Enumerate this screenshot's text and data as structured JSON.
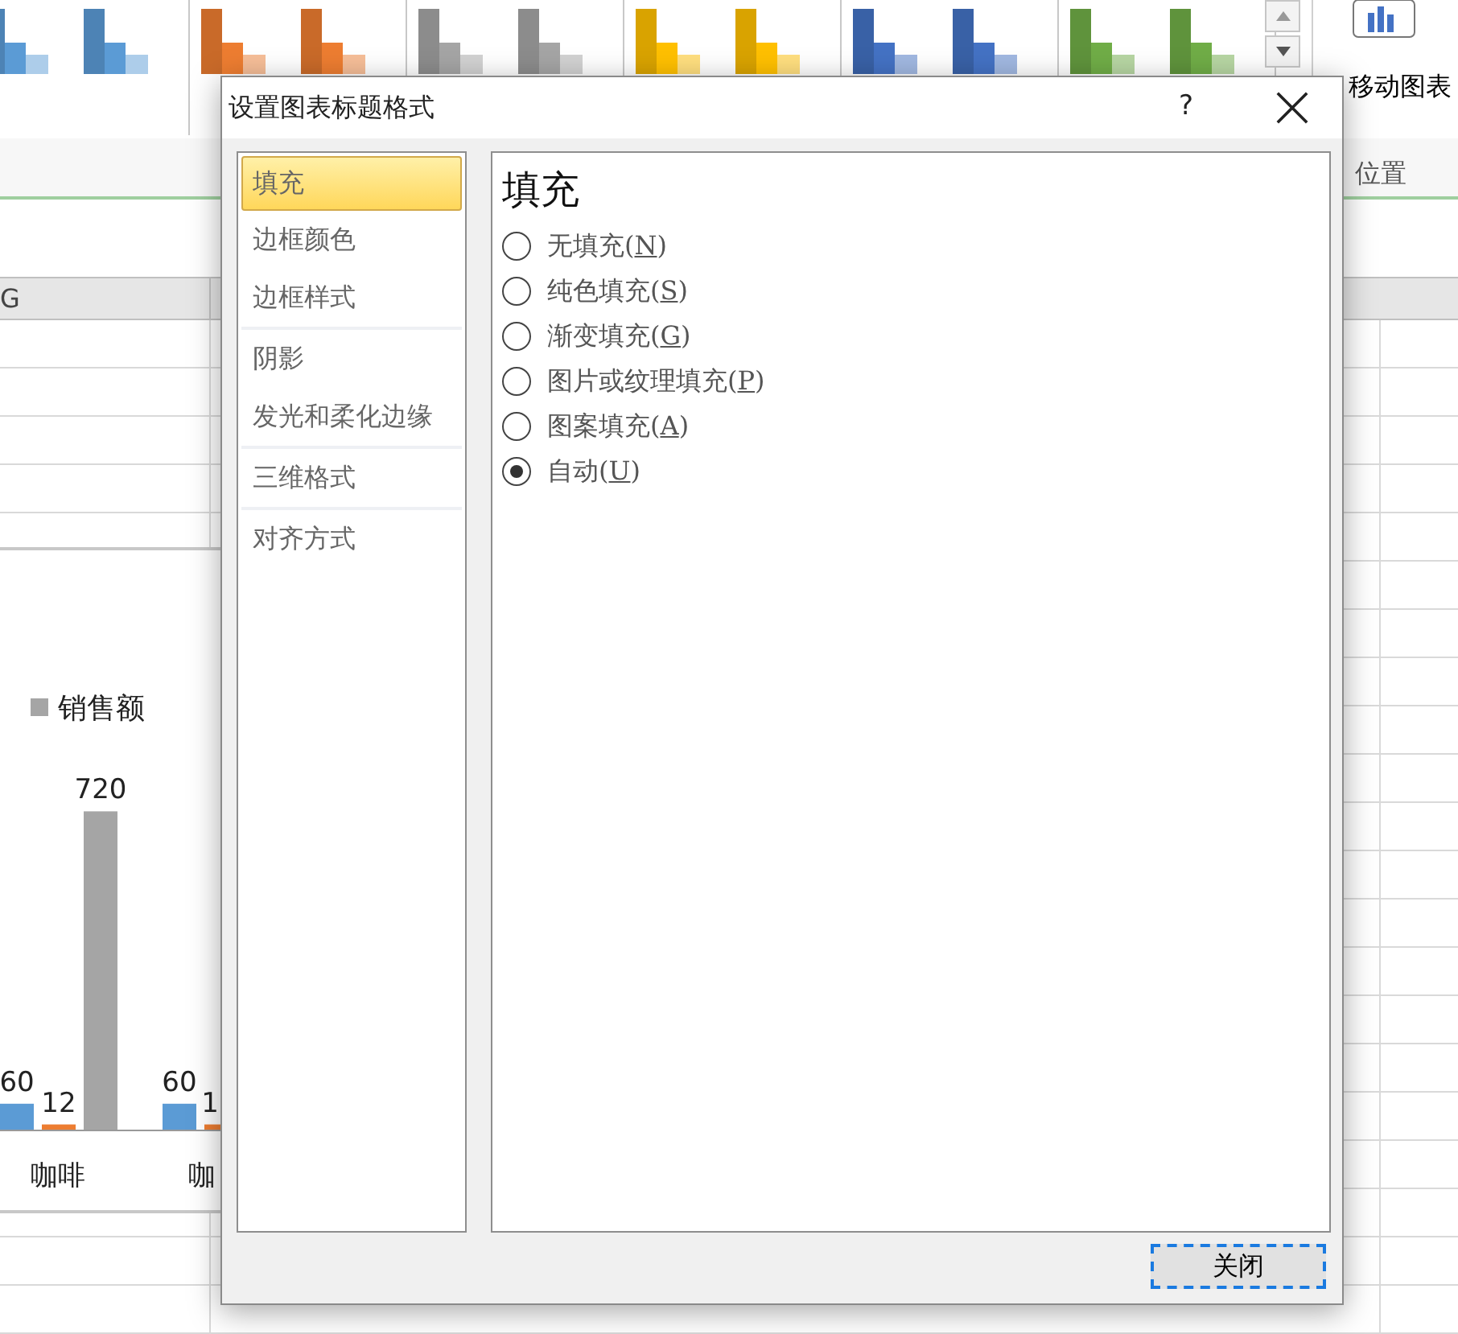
{
  "ribbon": {
    "chart_styles": [
      {
        "color": "#5b9bd5"
      },
      {
        "color": "#5b9bd5"
      },
      {
        "color": "#ed7d31"
      },
      {
        "color": "#ed7d31"
      },
      {
        "color": "#a5a5a5"
      },
      {
        "color": "#a5a5a5"
      },
      {
        "color": "#ffc000"
      },
      {
        "color": "#ffc000"
      },
      {
        "color": "#4472c4"
      },
      {
        "color": "#4472c4"
      },
      {
        "color": "#70ad47"
      },
      {
        "color": "#70ad47"
      }
    ],
    "move_chart_button": "移动图表",
    "group_label": "位置"
  },
  "sheet": {
    "column_header": "G"
  },
  "chart": {
    "legend": [
      {
        "label": "销售额",
        "color": "#a5a5a5"
      }
    ],
    "groups": [
      {
        "category": "咖啡",
        "bars": [
          {
            "value_label": "60",
            "color": "#5b9bd5",
            "level": 0.07
          },
          {
            "value_label": "12",
            "color": "#ed7d31",
            "level": 0.014
          },
          {
            "value_label": "720",
            "color": "#a5a5a5",
            "level": 0.86
          }
        ]
      },
      {
        "category": "咖",
        "bars": [
          {
            "value_label": "60",
            "color": "#5b9bd5",
            "level": 0.07
          },
          {
            "value_label": "1",
            "color": "#ed7d31",
            "level": 0.014
          }
        ]
      }
    ]
  },
  "dialog": {
    "title": "设置图表标题格式",
    "help": "?",
    "nav_sections": [
      [
        {
          "label": "填充",
          "selected": true
        },
        {
          "label": "边框颜色",
          "selected": false
        },
        {
          "label": "边框样式",
          "selected": false
        }
      ],
      [
        {
          "label": "阴影",
          "selected": false
        },
        {
          "label": "发光和柔化边缘",
          "selected": false
        }
      ],
      [
        {
          "label": "三维格式",
          "selected": false
        }
      ],
      [
        {
          "label": "对齐方式",
          "selected": false
        }
      ]
    ],
    "section_title": "填充",
    "options": [
      {
        "label": "无填充(N)",
        "selected": false
      },
      {
        "label": "纯色填充(S)",
        "selected": false
      },
      {
        "label": "渐变填充(G)",
        "selected": false
      },
      {
        "label": "图片或纹理填充(P)",
        "selected": false
      },
      {
        "label": "图案填充(A)",
        "selected": false
      },
      {
        "label": "自动(U)",
        "selected": true
      }
    ],
    "close_button": "关闭"
  }
}
